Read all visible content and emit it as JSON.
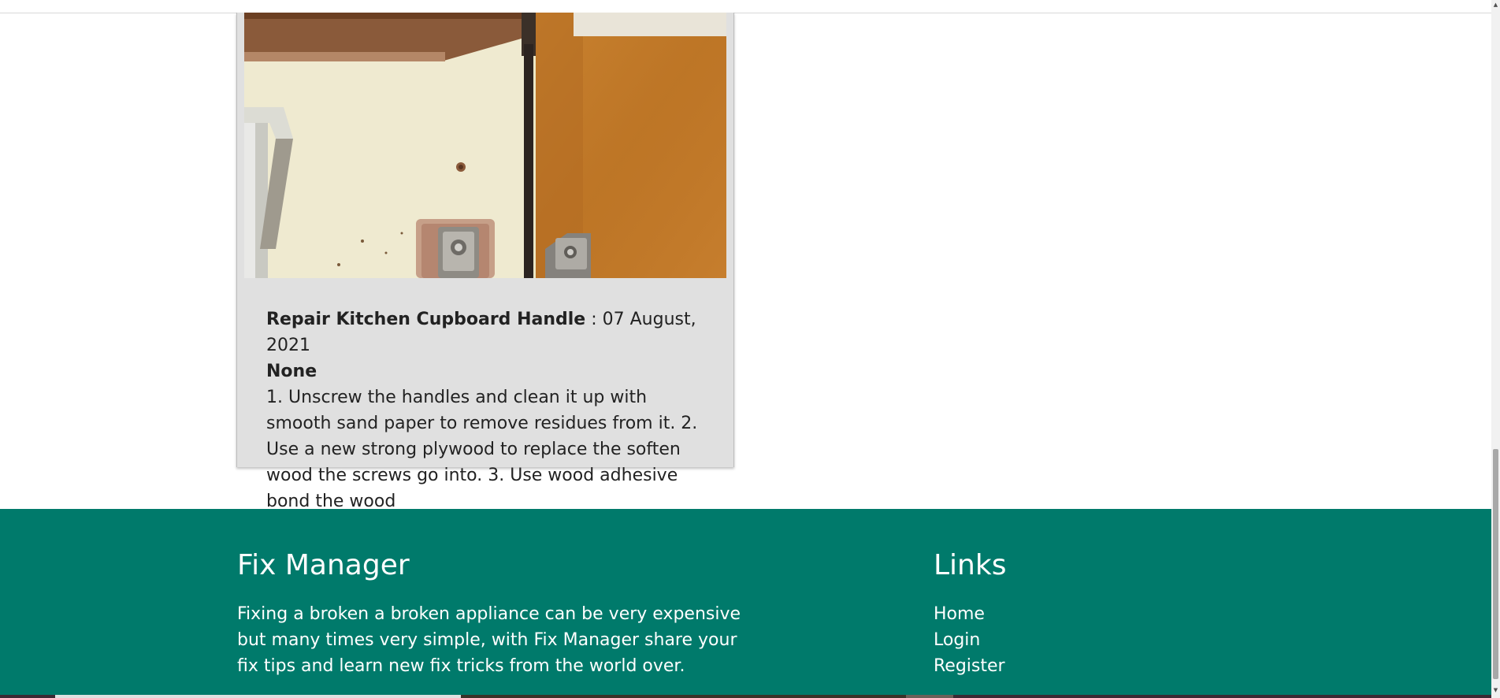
{
  "post": {
    "image_alt": "Kitchen cupboard handle hinge",
    "title": "Repair Kitchen Cupboard Handle",
    "date_sep": " : ",
    "date": "07 August, 2021",
    "status": "None",
    "description": "1. Unscrew the handles and clean it up with smooth sand paper to remove residues from it. 2. Use a new strong plywood to replace the soften wood the screws go into. 3. Use wood adhesive bond the wood"
  },
  "footer": {
    "brand": "Fix Manager",
    "about": "Fixing a broken a broken appliance can be very expensive but many times very simple, with Fix Manager share your fix tips and learn new fix tricks from the world over.",
    "links_heading": "Links",
    "links": [
      {
        "label": "Home"
      },
      {
        "label": "Login"
      },
      {
        "label": "Register"
      }
    ]
  },
  "colors": {
    "footer_bg": "#007a6b",
    "card_bg": "#e0e0e0"
  },
  "icons": {
    "scroll_up": "caret-up-icon",
    "scroll_down": "caret-down-icon"
  }
}
